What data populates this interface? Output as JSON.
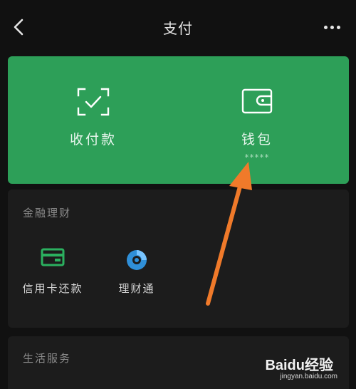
{
  "header": {
    "title": "支付",
    "back_icon": "chevron-left-icon",
    "more_icon": "more-dots-icon"
  },
  "pay_card": {
    "color": "#2d9f58",
    "receive": {
      "label": "收付款",
      "icon": "scan-check-icon"
    },
    "wallet": {
      "label": "钱包",
      "balance_masked": "*****",
      "icon": "wallet-icon"
    }
  },
  "finance": {
    "title": "金融理财",
    "items": [
      {
        "label": "信用卡还款",
        "icon": "credit-card-icon"
      },
      {
        "label": "理财通",
        "icon": "licaitong-icon"
      }
    ]
  },
  "life": {
    "title": "生活服务"
  },
  "annotation": {
    "arrow_color": "#f07a2a"
  },
  "watermark": {
    "brand": "Baidu经验",
    "url": "jingyan.baidu.com"
  }
}
